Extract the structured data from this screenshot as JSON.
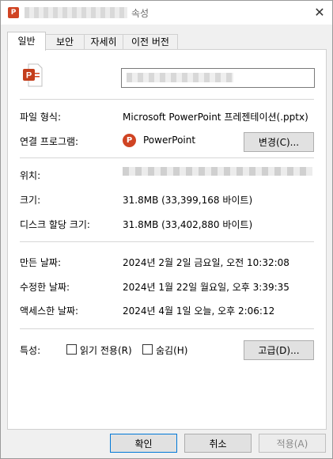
{
  "window": {
    "title": "속성",
    "close_label": "✕"
  },
  "tabs": [
    {
      "label": "일반",
      "active": true
    },
    {
      "label": "보안"
    },
    {
      "label": "자세히"
    },
    {
      "label": "이전 버전"
    }
  ],
  "general": {
    "file_type_label": "파일 형식:",
    "file_type_value": "Microsoft PowerPoint 프레젠테이션(.pptx)",
    "opens_with_label": "연결 프로그램:",
    "opens_with_value": "PowerPoint",
    "change_button": "변경(C)...",
    "location_label": "위치:",
    "size_label": "크기:",
    "size_value": "31.8MB (33,399,168 바이트)",
    "disk_size_label": "디스크 할당 크기:",
    "disk_size_value": "31.8MB (33,402,880 바이트)",
    "created_label": "만든 날짜:",
    "created_value": "2024년 2월 2일 금요일, 오전 10:32:08",
    "modified_label": "수정한 날짜:",
    "modified_value": "2024년 1월 22일 월요일, 오후 3:39:35",
    "accessed_label": "액세스한 날짜:",
    "accessed_value": "2024년 4월 1일 오늘, 오후 2:06:12",
    "attributes_label": "특성:",
    "readonly_label": "읽기 전용(R)",
    "hidden_label": "숨김(H)",
    "advanced_button": "고급(D)..."
  },
  "footer": {
    "ok": "확인",
    "cancel": "취소",
    "apply": "적용(A)"
  },
  "icons": {
    "file": "powerpoint-file-icon",
    "app": "powerpoint-app-icon"
  },
  "colors": {
    "accent": "#0078d7",
    "powerpoint": "#d04423"
  }
}
